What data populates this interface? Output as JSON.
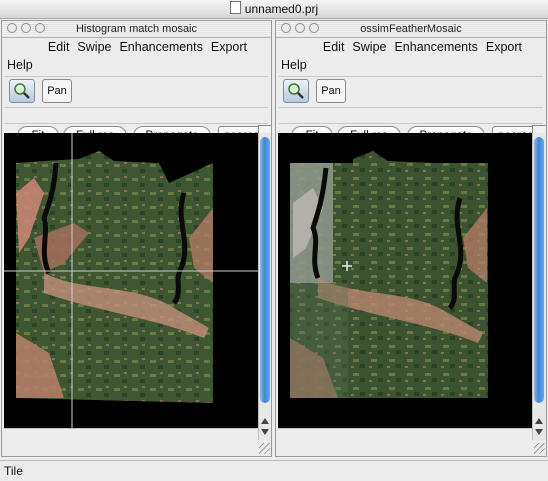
{
  "app": {
    "title": "unnamed0.prj"
  },
  "left_window": {
    "title": "Histogram match mosaic",
    "menus": [
      "Edit",
      "Swipe",
      "Enhancements",
      "Export"
    ],
    "help_menu": "Help",
    "pan_label": "Pan",
    "buttons": {
      "fit": "Fit",
      "full_res": "Full res",
      "propagate": "Propagate"
    },
    "resample": "nearest",
    "more": "»"
  },
  "right_window": {
    "title": "ossimFeatherMosaic",
    "menus": [
      "Edit",
      "Swipe",
      "Enhancements",
      "Export"
    ],
    "help_menu": "Help",
    "pan_label": "Pan",
    "buttons": {
      "fit": "Fit",
      "full_res": "Full res",
      "propagate": "Propagate"
    },
    "resample": "nearest",
    "more": "»"
  },
  "status": {
    "text": "Tile"
  },
  "colors": {
    "scroll_thumb": "#3f86d6",
    "viewport_bg": "#000000",
    "crosshair": "#cfcfcf",
    "imagery_green": "#3f5a33",
    "imagery_pink": "#c07a68"
  },
  "icons": [
    "doc-icon",
    "zoom-icon",
    "crosshair-cursor-icon"
  ]
}
